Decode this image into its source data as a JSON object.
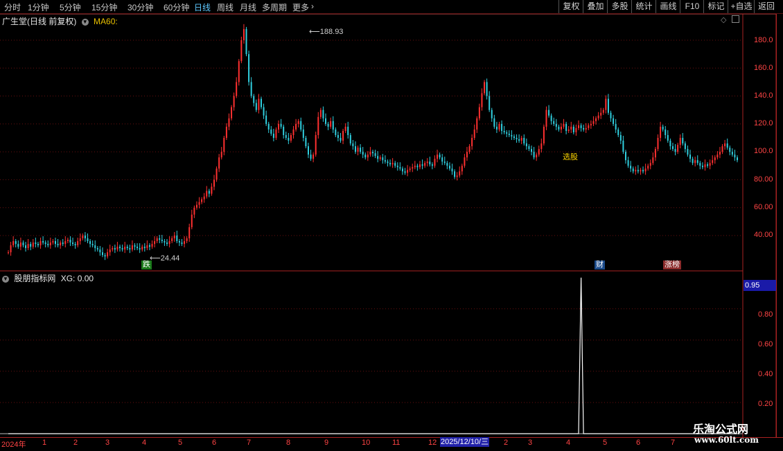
{
  "toolbar": {
    "periods": [
      "分时",
      "1分钟",
      "5分钟",
      "15分钟",
      "30分钟",
      "60分钟",
      "日线",
      "周线",
      "月线",
      "多周期",
      "更多"
    ],
    "active_period": "日线",
    "right_buttons": [
      "复权",
      "叠加",
      "多股",
      "统计",
      "画线",
      "F10",
      "标记",
      "+自选",
      "返回"
    ]
  },
  "main_chart": {
    "title": "广生堂(日线 前复权)",
    "indicator": "MA60:",
    "high_label": "188.93",
    "low_label": "24.44",
    "tags": [
      "跌",
      "财",
      "涨榜",
      "选股"
    ]
  },
  "sub_chart": {
    "title": "股朋指标网",
    "indicator": "XG: 0.00",
    "current_value": "0.95"
  },
  "date_axis": {
    "labels": [
      "2024年",
      "1",
      "2",
      "3",
      "4",
      "5",
      "6",
      "7",
      "8",
      "9",
      "10",
      "11",
      "12",
      "2",
      "3",
      "4",
      "5",
      "6",
      "7"
    ],
    "selected": "2025/12/10/三"
  },
  "watermark": {
    "title": "乐淘公式网",
    "url": "www.60lt.com"
  },
  "chart_data": [
    {
      "type": "candlestick",
      "title": "广生堂(日线 前复权)",
      "ylim": [
        24.44,
        188.93
      ],
      "y_ticks": [
        40,
        60,
        80,
        100,
        120,
        140,
        160,
        180
      ],
      "series": [
        {
          "name": "MA60"
        }
      ],
      "annotations": [
        {
          "label": "188.93",
          "kind": "high"
        },
        {
          "label": "24.44",
          "kind": "low"
        }
      ],
      "closes": [
        28,
        33,
        36,
        34,
        32,
        35,
        33,
        31,
        34,
        32,
        35,
        34,
        33,
        36,
        35,
        34,
        33,
        35,
        36,
        34,
        33,
        35,
        34,
        36,
        37,
        35,
        34,
        33,
        36,
        38,
        40,
        38,
        36,
        34,
        33,
        31,
        30,
        28,
        26,
        25,
        28,
        30,
        31,
        30,
        32,
        31,
        30,
        32,
        31,
        30,
        33,
        32,
        31,
        30,
        32,
        31,
        33,
        32,
        34,
        36,
        38,
        37,
        36,
        35,
        34,
        36,
        38,
        40,
        36,
        35,
        34,
        36,
        38,
        46,
        55,
        60,
        62,
        64,
        66,
        68,
        72,
        70,
        75,
        80,
        88,
        96,
        100,
        110,
        118,
        124,
        132,
        140,
        150,
        165,
        180,
        188,
        170,
        150,
        140,
        135,
        130,
        138,
        132,
        126,
        120,
        116,
        113,
        110,
        116,
        120,
        118,
        112,
        110,
        108,
        112,
        116,
        120,
        122,
        116,
        110,
        104,
        98,
        95,
        98,
        112,
        125,
        130,
        124,
        120,
        118,
        122,
        116,
        112,
        110,
        108,
        115,
        118,
        112,
        106,
        104,
        100,
        103,
        100,
        98,
        96,
        98,
        100,
        99,
        97,
        95,
        96,
        94,
        93,
        92,
        91,
        92,
        90,
        89,
        88,
        86,
        85,
        87,
        88,
        89,
        90,
        89,
        91,
        90,
        92,
        93,
        91,
        90,
        95,
        98,
        96,
        93,
        92,
        90,
        88,
        86,
        82,
        83,
        86,
        90,
        96,
        100,
        104,
        110,
        116,
        124,
        132,
        142,
        150,
        140,
        130,
        124,
        118,
        116,
        120,
        115,
        114,
        113,
        112,
        111,
        110,
        109,
        108,
        110,
        106,
        104,
        102,
        100,
        96,
        98,
        102,
        106,
        118,
        130,
        126,
        122,
        120,
        118,
        116,
        118,
        120,
        115,
        116,
        118,
        114,
        117,
        119,
        117,
        116,
        117,
        119,
        120,
        122,
        124,
        126,
        128,
        130,
        138,
        128,
        124,
        120,
        116,
        112,
        108,
        100,
        94,
        90,
        88,
        86,
        87,
        86,
        87,
        86,
        88,
        90,
        92,
        96,
        102,
        110,
        118,
        116,
        112,
        108,
        104,
        102,
        100,
        105,
        110,
        106,
        102,
        98,
        95,
        92,
        94,
        92,
        90,
        89,
        91,
        90,
        92,
        94,
        96,
        98,
        100,
        104,
        106,
        103,
        100,
        98,
        96,
        94
      ]
    },
    {
      "type": "line",
      "title": "股朋指标网",
      "ylim": [
        0,
        0.95
      ],
      "y_ticks": [
        0.2,
        0.4,
        0.6,
        0.8
      ],
      "series": [
        {
          "name": "XG",
          "values": [
            0,
            0,
            0,
            0,
            0,
            0,
            0,
            0,
            0,
            0,
            0,
            0,
            0,
            0,
            0,
            0,
            0,
            0,
            0,
            0,
            0,
            0,
            0,
            0,
            0,
            0,
            0,
            0,
            0,
            0,
            0,
            0,
            0,
            0,
            0,
            0,
            0,
            0,
            0,
            0,
            0,
            0,
            0,
            0,
            0,
            0,
            0,
            0,
            0,
            0,
            0,
            0,
            0,
            0,
            0,
            0,
            0,
            0,
            0,
            0,
            0,
            0,
            0,
            0,
            0,
            0,
            0,
            0,
            0,
            0,
            0,
            0,
            0,
            0,
            0,
            0,
            0,
            0,
            0,
            0,
            0,
            0,
            0,
            0,
            0,
            0,
            0,
            0,
            0,
            0,
            0,
            0,
            0,
            0,
            0,
            0,
            0,
            0,
            0,
            0,
            0,
            0,
            0,
            0,
            0,
            0,
            0,
            0,
            0,
            0,
            0,
            0,
            0,
            0,
            0,
            0,
            0,
            0,
            0,
            0,
            0,
            0,
            0,
            0,
            0,
            0,
            0,
            0,
            0,
            0,
            0,
            0,
            0,
            0,
            0,
            0,
            0,
            0,
            0,
            0,
            0,
            0,
            0,
            0,
            0,
            0,
            0,
            0,
            0,
            0,
            0,
            0,
            0,
            0,
            0,
            0,
            0,
            0,
            0,
            0,
            0,
            0,
            0,
            0,
            0,
            0,
            0,
            0,
            0,
            0,
            0,
            0,
            0,
            0,
            0,
            0,
            0,
            0,
            0,
            0,
            0,
            0,
            0,
            0,
            0,
            0,
            0,
            0,
            0,
            0,
            0,
            0,
            0,
            0,
            0,
            0,
            0,
            0,
            0,
            0,
            0,
            0,
            0,
            0,
            0,
            0,
            0,
            0,
            0,
            0,
            0,
            0,
            0,
            0,
            0,
            0,
            0,
            0,
            0,
            0,
            0,
            0,
            0,
            0,
            0,
            0,
            0,
            0,
            0,
            0,
            0,
            1,
            0,
            0,
            0,
            0,
            0,
            0,
            0,
            0,
            0,
            0,
            0,
            0,
            0,
            0,
            0,
            0,
            0,
            0,
            0,
            0,
            0,
            0,
            0,
            0,
            0,
            0,
            0,
            0,
            0,
            0,
            0,
            0,
            0,
            0,
            0,
            0,
            0,
            0,
            0,
            0,
            0,
            0,
            0,
            0,
            0,
            0,
            0,
            0,
            0,
            0,
            0,
            0,
            0,
            0,
            0,
            0,
            0,
            0,
            0,
            0,
            0,
            0,
            0
          ]
        }
      ]
    }
  ]
}
